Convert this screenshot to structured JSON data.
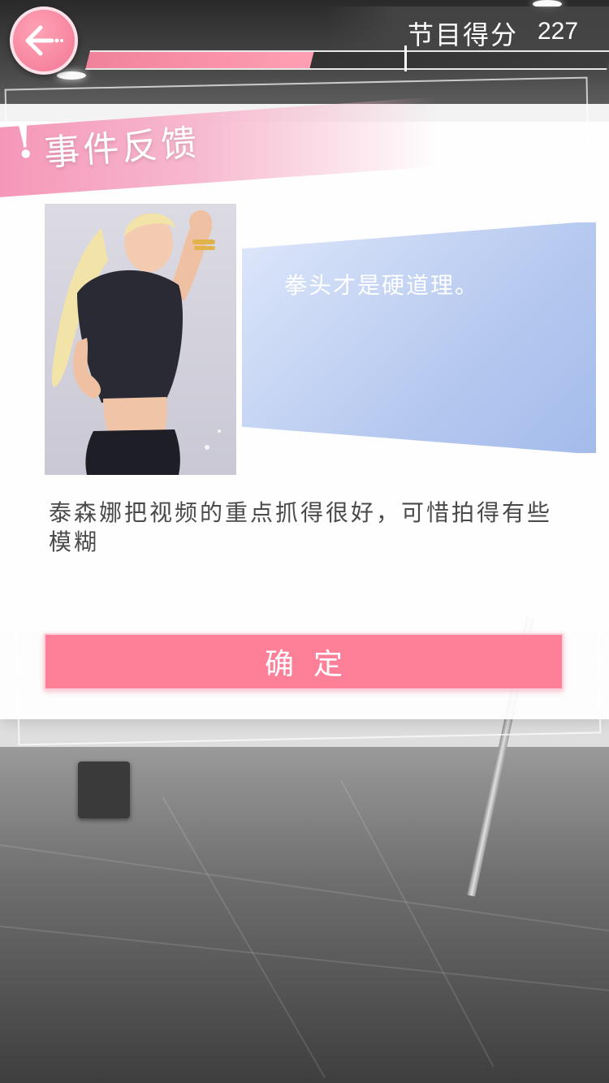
{
  "header": {
    "score_label": "节目得分",
    "score_value": "227",
    "score_progress": 0.43
  },
  "dialog": {
    "title": "事件反馈",
    "title_mark": "!",
    "character_speech": "拳头才是硬道理。",
    "feedback": "泰森娜把视频的重点抓得很好，可惜拍得有些模糊",
    "confirm_label": "确定"
  },
  "colors": {
    "accent_pink": "#fe7f98",
    "bubble_blue": "#b6c9ef"
  },
  "icons": {
    "back": "back-arrow-icon"
  }
}
